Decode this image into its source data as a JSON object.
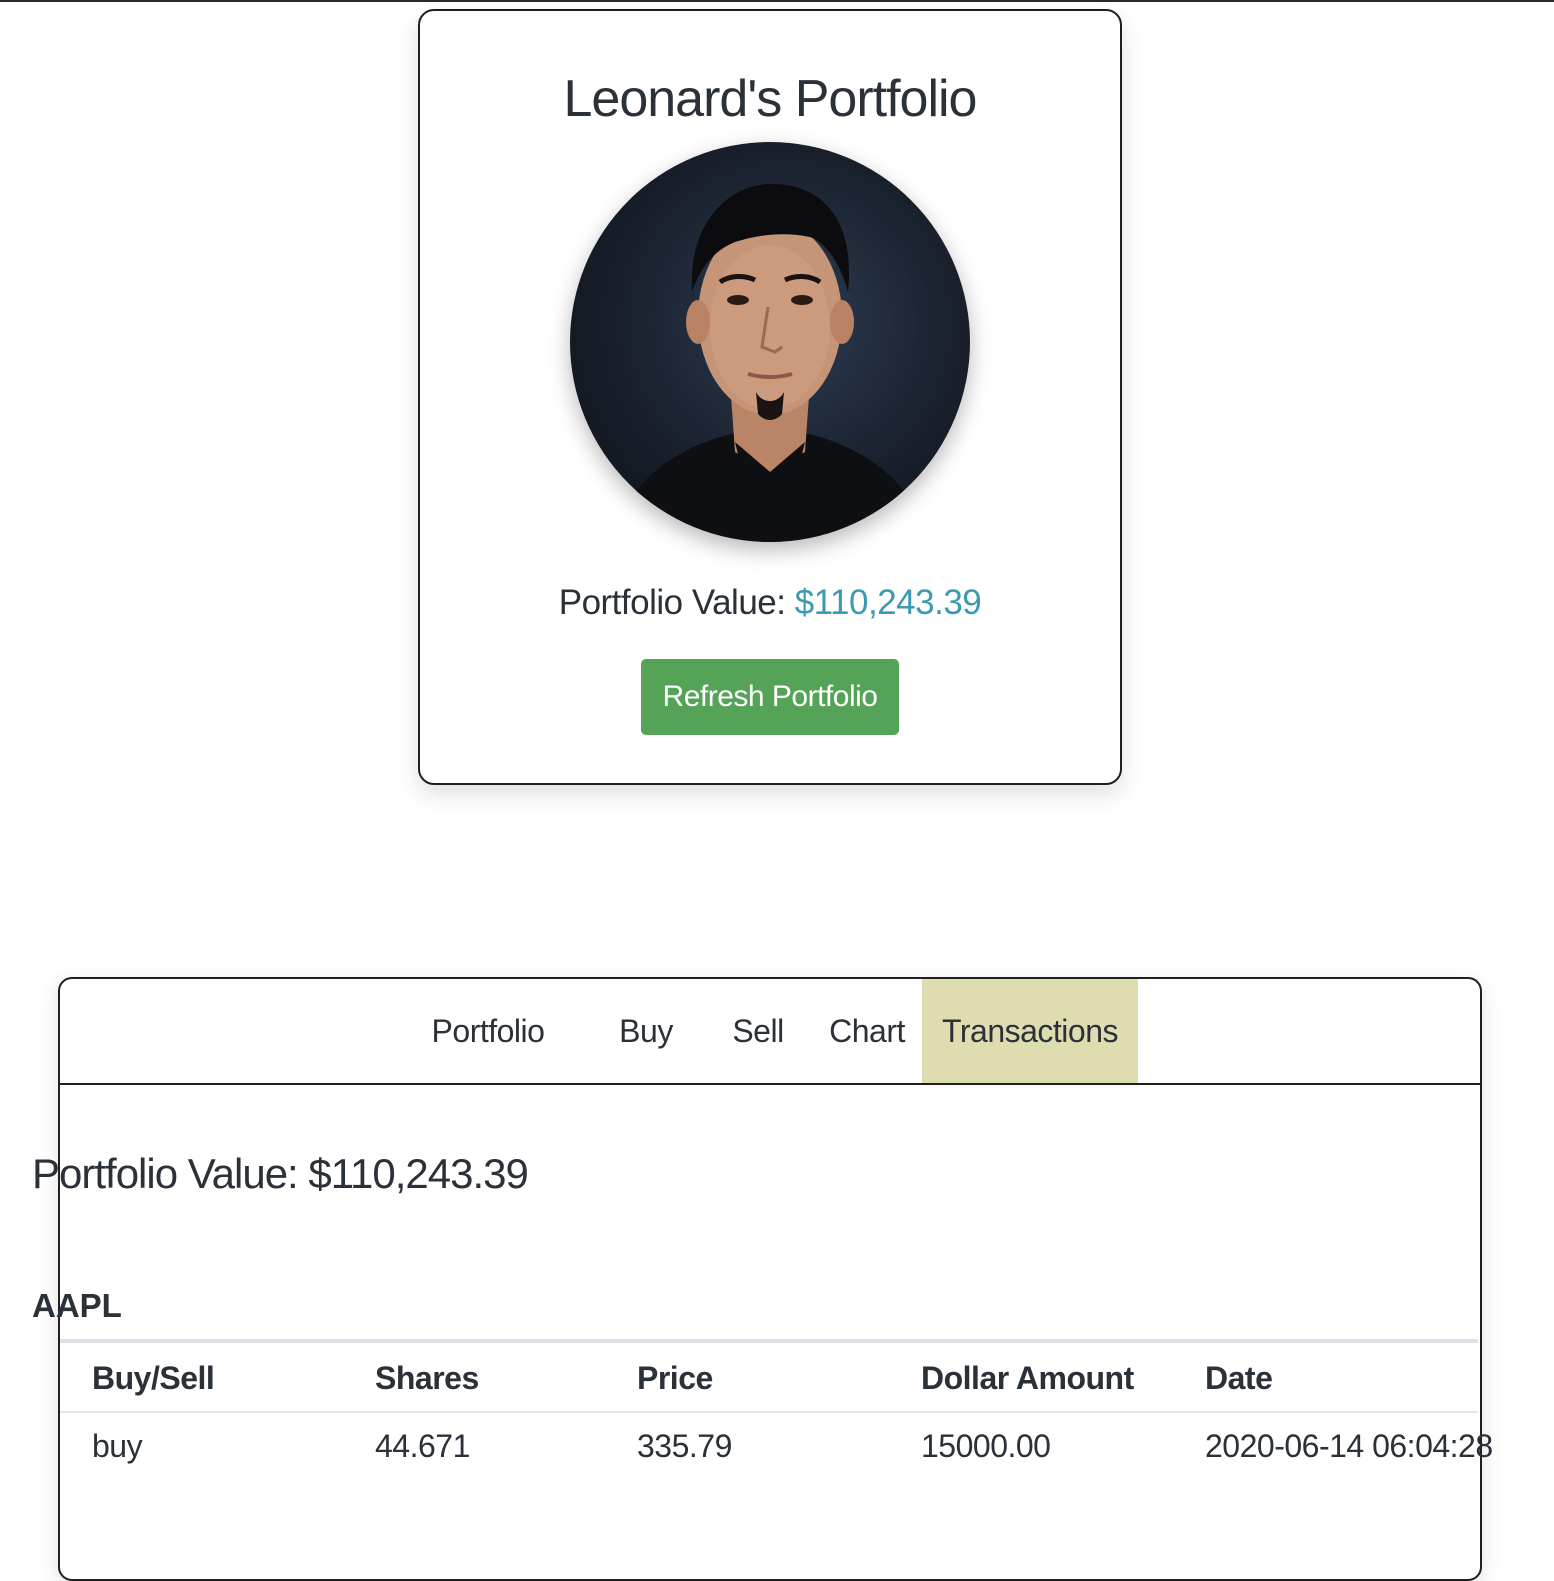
{
  "profile": {
    "title": "Leonard's Portfolio",
    "value_label": "Portfolio Value: ",
    "value_amount": "$110,243.39",
    "refresh_label": "Refresh Portfolio"
  },
  "tabs": [
    {
      "label": "Portfolio"
    },
    {
      "label": "Buy"
    },
    {
      "label": "Sell"
    },
    {
      "label": "Chart"
    },
    {
      "label": "Transactions",
      "active": true
    }
  ],
  "panel": {
    "value_text": "Portfolio Value: $110,243.39",
    "ticker": "AAPL",
    "columns": [
      "Buy/Sell",
      "Shares",
      "Price",
      "Dollar Amount",
      "Date"
    ],
    "rows": [
      [
        "buy",
        "44.671",
        "335.79",
        "15000.00",
        "2020-06-14 06:04:28"
      ]
    ]
  },
  "colors": {
    "accent_value": "#3b9ab0",
    "refresh_button": "#54a356",
    "active_tab": "#dfdcb0"
  }
}
